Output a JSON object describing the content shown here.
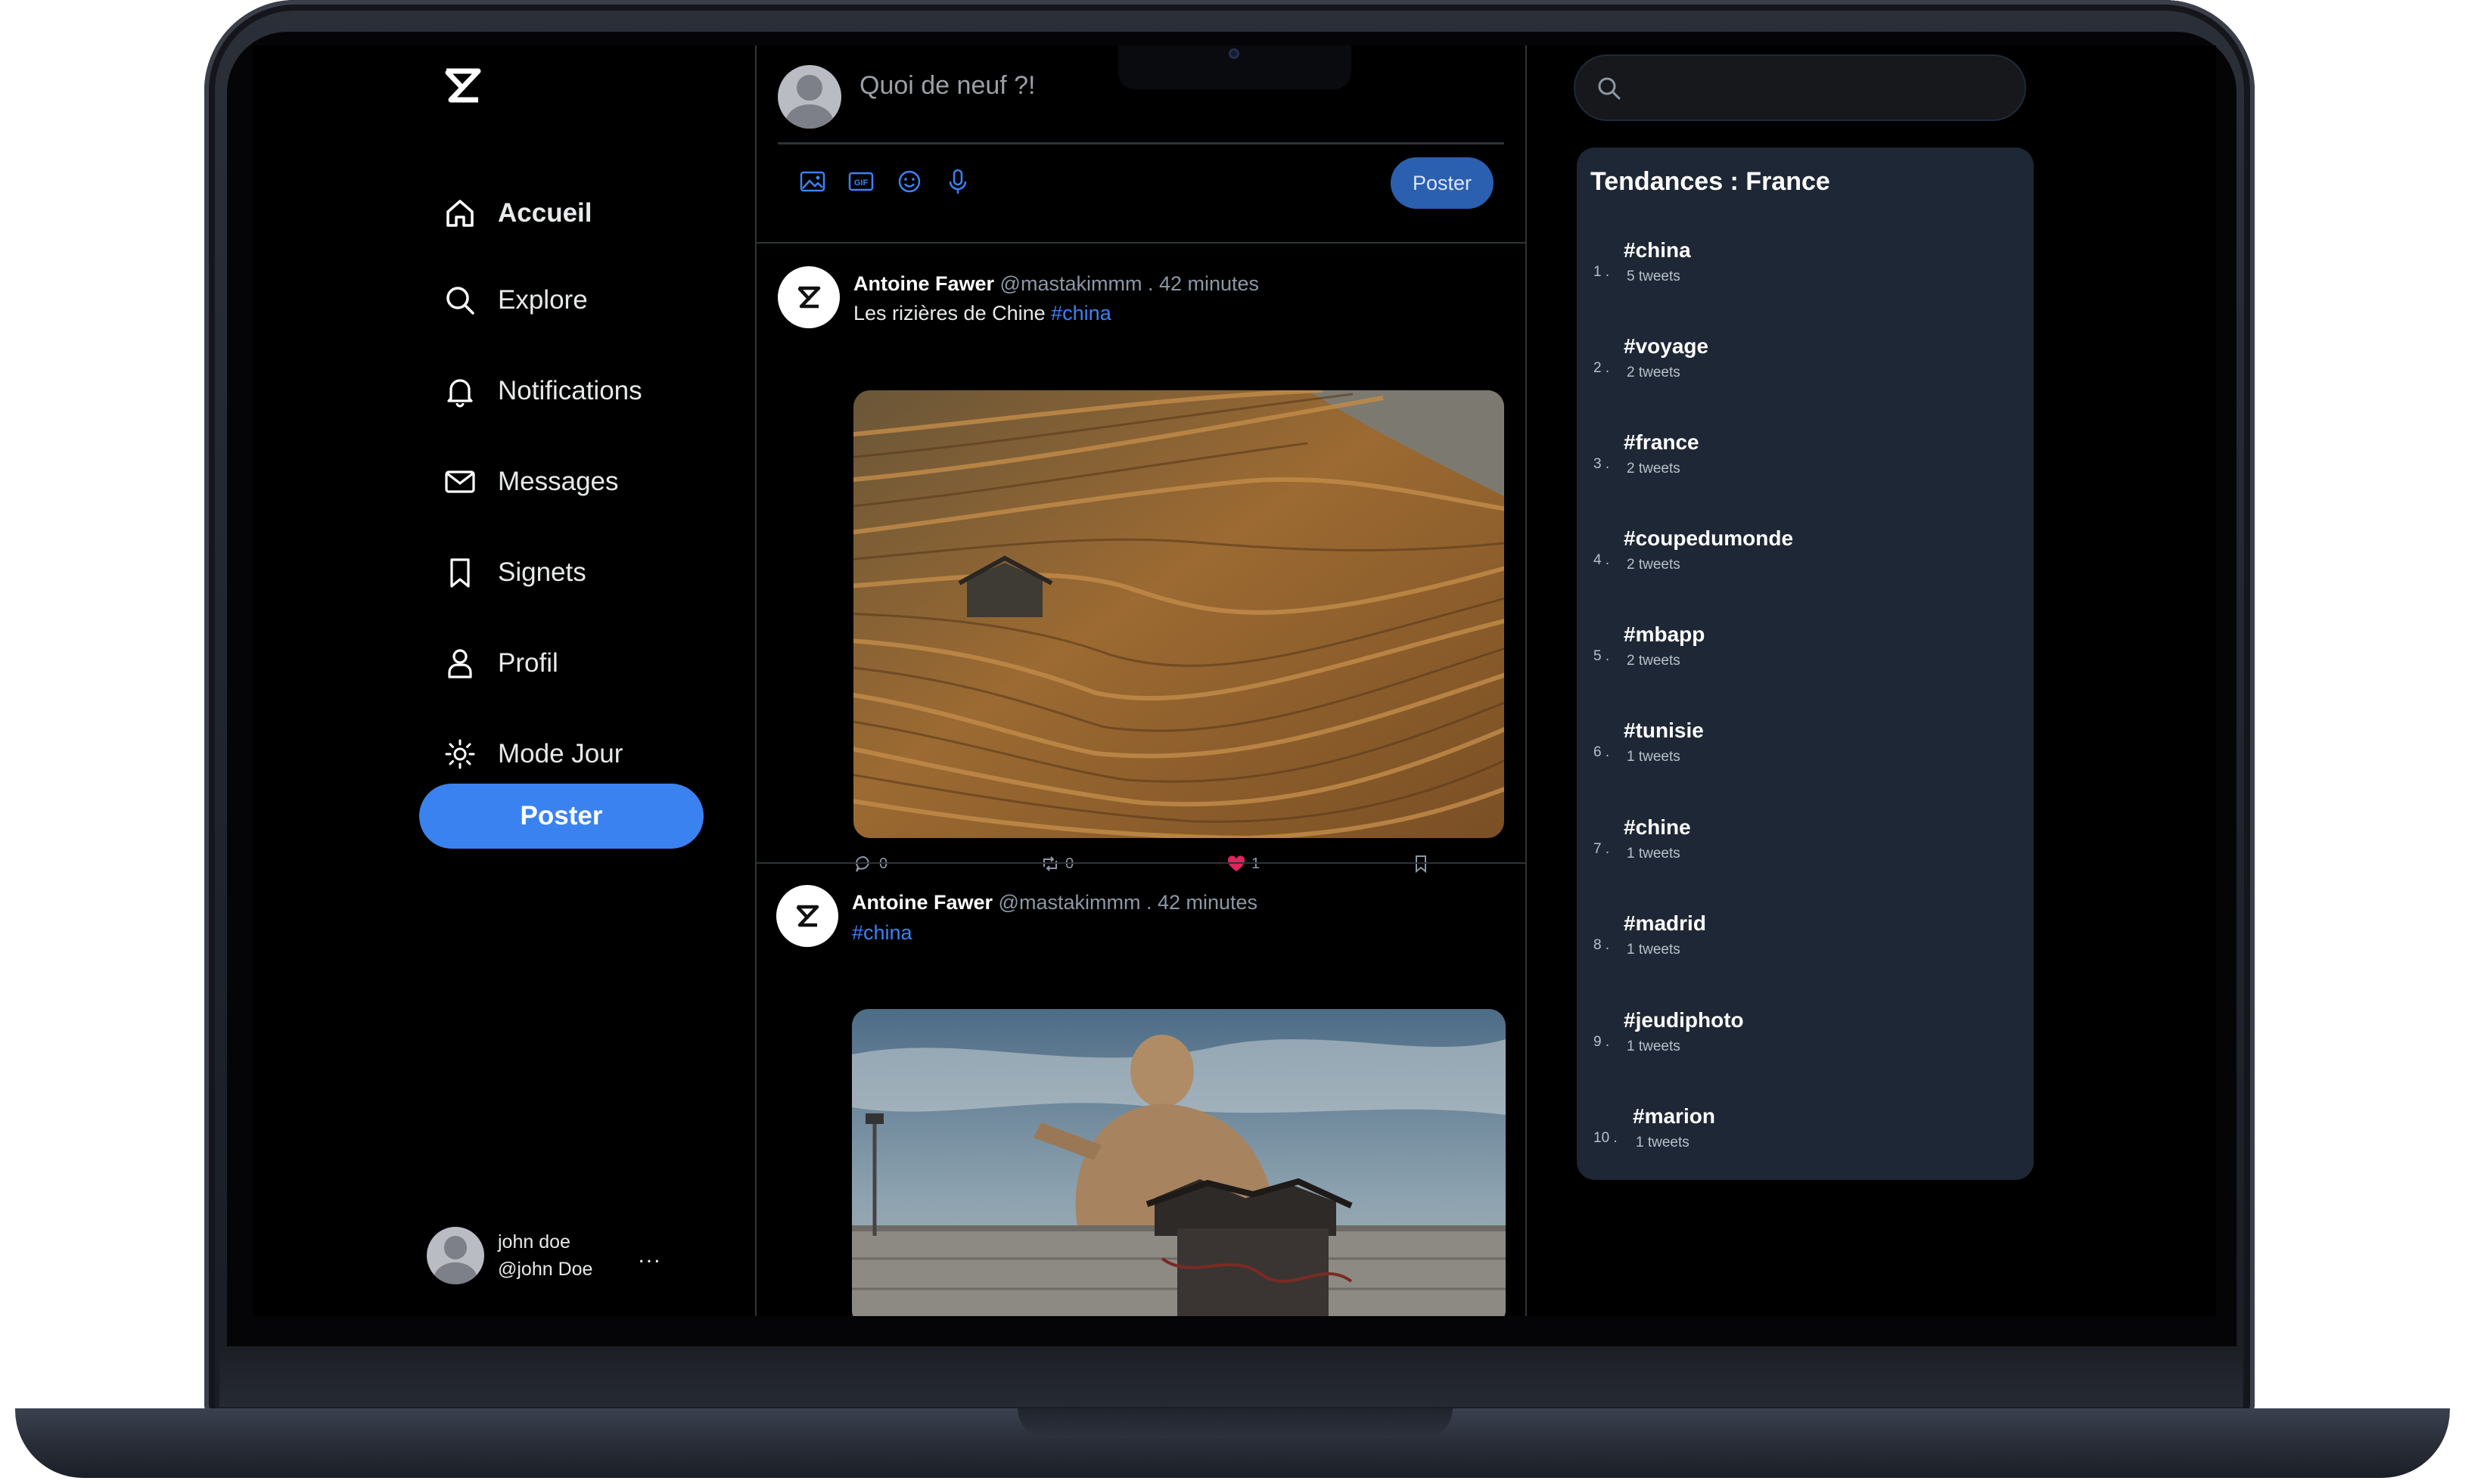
{
  "sidebar": {
    "nav": [
      {
        "label": "Accueil",
        "icon": "home-icon",
        "active": true
      },
      {
        "label": "Explore",
        "icon": "search-icon"
      },
      {
        "label": "Notifications",
        "icon": "bell-icon"
      },
      {
        "label": "Messages",
        "icon": "envelope-icon"
      },
      {
        "label": "Signets",
        "icon": "bookmark-icon"
      },
      {
        "label": "Profil",
        "icon": "user-icon"
      },
      {
        "label": "Mode Jour",
        "icon": "sun-icon"
      }
    ],
    "post_button": "Poster",
    "account": {
      "name": "john doe",
      "handle": "@john Doe",
      "more": "..."
    }
  },
  "compose": {
    "placeholder": "Quoi de neuf ?!",
    "tools": [
      "image-icon",
      "gif-icon",
      "emoji-icon",
      "microphone-icon"
    ],
    "post_button": "Poster"
  },
  "tweets": [
    {
      "name": "Antoine Fawer",
      "handle": "@mastakimmm",
      "time": ". 42 minutes",
      "text": "Les rizières de Chine ",
      "hashtag": "#china",
      "image": "rice-terraces-photo",
      "replies": "0",
      "retweets": "0",
      "likes": "1"
    },
    {
      "name": "Antoine Fawer",
      "handle": "@mastakimmm",
      "time": ". 42 minutes",
      "text": "",
      "hashtag": "#china",
      "image": "buddha-statue-photo"
    }
  ],
  "trends": {
    "title": "Tendances : France",
    "items": [
      {
        "rank": "1 .",
        "tag": "#china",
        "count": "5 tweets"
      },
      {
        "rank": "2 .",
        "tag": "#voyage",
        "count": "2 tweets"
      },
      {
        "rank": "3 .",
        "tag": "#france",
        "count": "2 tweets"
      },
      {
        "rank": "4 .",
        "tag": "#coupedumonde",
        "count": "2 tweets"
      },
      {
        "rank": "5 .",
        "tag": "#mbapp",
        "count": "2 tweets"
      },
      {
        "rank": "6 .",
        "tag": "#tunisie",
        "count": "1 tweets"
      },
      {
        "rank": "7 .",
        "tag": "#chine",
        "count": "1 tweets"
      },
      {
        "rank": "8 .",
        "tag": "#madrid",
        "count": "1 tweets"
      },
      {
        "rank": "9 .",
        "tag": "#jeudiphoto",
        "count": "1 tweets"
      },
      {
        "rank": "10 .",
        "tag": "#marion",
        "count": "1 tweets"
      }
    ]
  },
  "colors": {
    "accent": "#3a82f0",
    "hashtag": "#3b82f6",
    "like": "#e0245e",
    "panel": "#1e2735"
  }
}
